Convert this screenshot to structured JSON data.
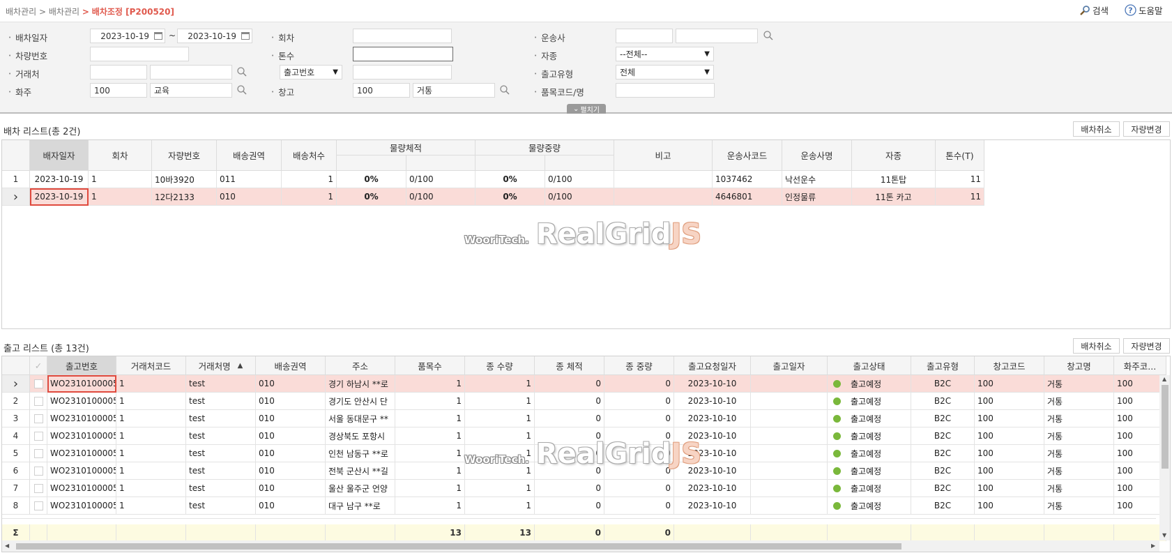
{
  "breadcrumb": {
    "level1": "배차관리",
    "sep": ">",
    "level2": "배차관리",
    "current": "배차조정 [P200520]"
  },
  "top_buttons": {
    "search": "검색",
    "help": "도움말"
  },
  "search": {
    "labels": {
      "dispatch_date": "배차일자",
      "round": "회차",
      "carrier": "운송사",
      "vehicle_no": "차량번호",
      "tonnage": "톤수",
      "vehicle_type": "자종",
      "client": "거래처",
      "outbound_type": "출고유형",
      "shipper": "화주",
      "warehouse": "창고",
      "item_code": "품목코드/명"
    },
    "date_from": "2023-10-19",
    "date_tilde": "~",
    "date_to": "2023-10-19",
    "vehicle_type_selected": "--전체--",
    "outbound_no_selected": "출고번호",
    "outbound_type_selected": "전체",
    "shipper_code": "100",
    "shipper_name": "교육",
    "warehouse_code": "100",
    "warehouse_name": "거통",
    "fold_label": "펼치기"
  },
  "dispatch_list": {
    "title": "배차 리스트(총 2건)",
    "btn_cancel": "배차취소",
    "btn_change": "자량변경",
    "headers": [
      "배자일자",
      "회차",
      "자량번호",
      "배송권역",
      "배송처수",
      "물량체적",
      "물량중량",
      "비고",
      "운송사코드",
      "운송사명",
      "자종",
      "톤수(T)"
    ],
    "rows": [
      {
        "num": "1",
        "date": "2023-10-19",
        "round": "1",
        "vehicle": "10바3920",
        "zone": "011",
        "dest": "1",
        "vol_pct": "0%",
        "vol": "0/100",
        "wt_pct": "0%",
        "wt": "0/100",
        "note": "",
        "code": "1037462",
        "carrier": "낙선운수",
        "type": "11톤탑",
        "ton": "11"
      },
      {
        "num": "",
        "date": "2023-10-19",
        "round": "1",
        "vehicle": "12다2133",
        "zone": "010",
        "dest": "1",
        "vol_pct": "0%",
        "vol": "0/100",
        "wt_pct": "0%",
        "wt": "0/100",
        "note": "",
        "code": "4646801",
        "carrier": "인정물류",
        "type": "11톤 카고",
        "ton": "11"
      }
    ]
  },
  "outbound_list": {
    "title": "출고 리스트 (총 13건)",
    "btn_cancel": "배차취소",
    "btn_change": "자량변경",
    "headers": [
      "출고번호",
      "거래처코드",
      "거래처명",
      "배송권역",
      "주소",
      "품목수",
      "종 수량",
      "종 체적",
      "종 중량",
      "출고요청일자",
      "출고일자",
      "출고상태",
      "출고유형",
      "창고코드",
      "창고명",
      "화주코..."
    ],
    "rows": [
      {
        "num": "",
        "no": "WO2310100005",
        "cc": "1",
        "cn": "test",
        "zone": "010",
        "addr": "경기 하남시 **로",
        "items": "1",
        "qty": "1",
        "vol": "0",
        "wt": "0",
        "req": "2023-10-10",
        "out": "",
        "status": "출고예정",
        "type": "B2C",
        "wc": "100",
        "wn": "거통",
        "sc": "100"
      },
      {
        "num": "2",
        "no": "WO2310100005",
        "cc": "1",
        "cn": "test",
        "zone": "010",
        "addr": "경기도 안산시 단",
        "items": "1",
        "qty": "1",
        "vol": "0",
        "wt": "0",
        "req": "2023-10-10",
        "out": "",
        "status": "출고예정",
        "type": "B2C",
        "wc": "100",
        "wn": "거통",
        "sc": "100"
      },
      {
        "num": "3",
        "no": "WO2310100005",
        "cc": "1",
        "cn": "test",
        "zone": "010",
        "addr": "서울 동대문구 **",
        "items": "1",
        "qty": "1",
        "vol": "0",
        "wt": "0",
        "req": "2023-10-10",
        "out": "",
        "status": "출고예정",
        "type": "B2C",
        "wc": "100",
        "wn": "거통",
        "sc": "100"
      },
      {
        "num": "4",
        "no": "WO2310100005",
        "cc": "1",
        "cn": "test",
        "zone": "010",
        "addr": "경상북도 포항시",
        "items": "1",
        "qty": "1",
        "vol": "0",
        "wt": "0",
        "req": "2023-10-10",
        "out": "",
        "status": "출고예정",
        "type": "B2C",
        "wc": "100",
        "wn": "거통",
        "sc": "100"
      },
      {
        "num": "5",
        "no": "WO2310100005",
        "cc": "1",
        "cn": "test",
        "zone": "010",
        "addr": "인천 남동구 **로",
        "items": "1",
        "qty": "1",
        "vol": "0",
        "wt": "0",
        "req": "2023-10-10",
        "out": "",
        "status": "출고예정",
        "type": "B2C",
        "wc": "100",
        "wn": "거통",
        "sc": "100"
      },
      {
        "num": "6",
        "no": "WO2310100005",
        "cc": "1",
        "cn": "test",
        "zone": "010",
        "addr": "전북 군산시 **길",
        "items": "1",
        "qty": "1",
        "vol": "0",
        "wt": "0",
        "req": "2023-10-10",
        "out": "",
        "status": "출고예정",
        "type": "B2C",
        "wc": "100",
        "wn": "거통",
        "sc": "100"
      },
      {
        "num": "7",
        "no": "WO2310100005",
        "cc": "1",
        "cn": "test",
        "zone": "010",
        "addr": "울산 울주군 언양",
        "items": "1",
        "qty": "1",
        "vol": "0",
        "wt": "0",
        "req": "2023-10-10",
        "out": "",
        "status": "출고예정",
        "type": "B2C",
        "wc": "100",
        "wn": "거통",
        "sc": "100"
      },
      {
        "num": "8",
        "no": "WO2310100005",
        "cc": "1",
        "cn": "test",
        "zone": "010",
        "addr": "대구 남구 **로",
        "items": "1",
        "qty": "1",
        "vol": "0",
        "wt": "0",
        "req": "2023-10-10",
        "out": "",
        "status": "출고예정",
        "type": "B2C",
        "wc": "100",
        "wn": "거통",
        "sc": "100"
      }
    ],
    "footer": {
      "sigma": "Σ",
      "items": "13",
      "qty": "13",
      "vol": "0",
      "wt": "0"
    }
  },
  "watermark": {
    "small": "WooriTech.",
    "big_a": "RealGrid",
    "big_b": "JS"
  },
  "colors": {
    "accent": "#e05a4e",
    "selected_row": "#fadcd8",
    "footer_bg": "#fdfbe1",
    "status_dot": "#7ab83b"
  }
}
